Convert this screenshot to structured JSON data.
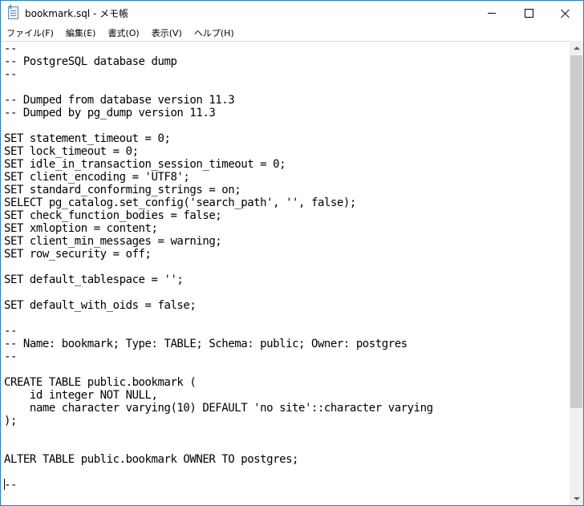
{
  "window": {
    "title": "bookmark.sql - メモ帳",
    "minimize_glyph": "minimize-icon",
    "maximize_glyph": "maximize-icon",
    "close_glyph": "close-icon"
  },
  "menu": [
    {
      "label": "ファイル(F)"
    },
    {
      "label": "編集(E)"
    },
    {
      "label": "書式(O)"
    },
    {
      "label": "表示(V)"
    },
    {
      "label": "ヘルプ(H)"
    }
  ],
  "editor": {
    "content": "--\n-- PostgreSQL database dump\n--\n\n-- Dumped from database version 11.3\n-- Dumped by pg_dump version 11.3\n\nSET statement_timeout = 0;\nSET lock_timeout = 0;\nSET idle_in_transaction_session_timeout = 0;\nSET client_encoding = 'UTF8';\nSET standard_conforming_strings = on;\nSELECT pg_catalog.set_config('search_path', '', false);\nSET check_function_bodies = false;\nSET xmloption = content;\nSET client_min_messages = warning;\nSET row_security = off;\n\nSET default_tablespace = '';\n\nSET default_with_oids = false;\n\n--\n-- Name: bookmark; Type: TABLE; Schema: public; Owner: postgres\n--\n\nCREATE TABLE public.bookmark (\n    id integer NOT NULL,\n    name character varying(10) DEFAULT 'no site'::character varying\n);\n\n\nALTER TABLE public.bookmark OWNER TO postgres;\n\n--"
  },
  "colors": {
    "border": "#1883d7",
    "scrollbar_track": "#f0f0f0",
    "scrollbar_thumb": "#cdcdcd"
  }
}
